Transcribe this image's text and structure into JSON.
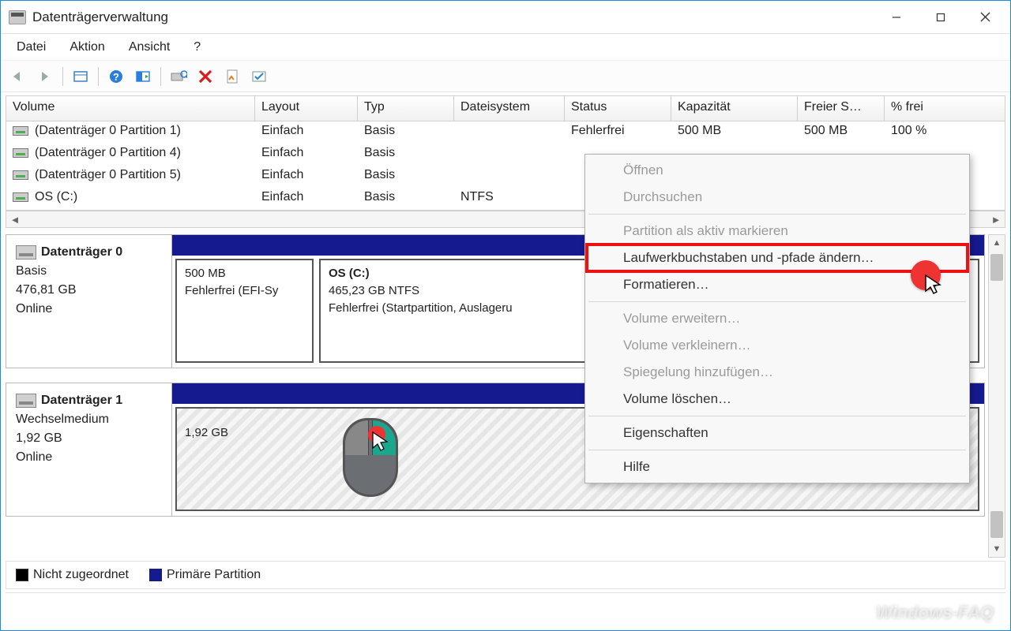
{
  "window": {
    "title": "Datenträgerverwaltung"
  },
  "menu": {
    "file": "Datei",
    "action": "Aktion",
    "view": "Ansicht",
    "help": "?"
  },
  "columns": {
    "volume": "Volume",
    "layout": "Layout",
    "type": "Typ",
    "fs": "Dateisystem",
    "status": "Status",
    "capacity": "Kapazität",
    "free": "Freier S…",
    "pfree": "% frei"
  },
  "volumes": [
    {
      "name": "(Datenträger 0 Partition 1)",
      "layout": "Einfach",
      "type": "Basis",
      "fs": "",
      "status": "Fehlerfrei",
      "capacity": "500 MB",
      "free": "500 MB",
      "pfree": "100 %"
    },
    {
      "name": "(Datenträger 0 Partition 4)",
      "layout": "Einfach",
      "type": "Basis",
      "fs": "",
      "status": "",
      "capacity": "",
      "free": "",
      "pfree": ""
    },
    {
      "name": "(Datenträger 0 Partition 5)",
      "layout": "Einfach",
      "type": "Basis",
      "fs": "",
      "status": "",
      "capacity": "",
      "free": "",
      "pfree": ""
    },
    {
      "name": "OS (C:)",
      "layout": "Einfach",
      "type": "Basis",
      "fs": "NTFS",
      "status": "",
      "capacity": "",
      "free": "",
      "pfree": ""
    }
  ],
  "disks": [
    {
      "name": "Datenträger 0",
      "type": "Basis",
      "size": "476,81 GB",
      "state": "Online",
      "parts": [
        {
          "title": "",
          "line1": "500 MB",
          "line2": "Fehlerfrei (EFI-Sy"
        },
        {
          "title": "OS  (C:)",
          "line1": "465,23 GB NTFS",
          "line2": "Fehlerfrei (Startpartition, Auslageru"
        }
      ]
    },
    {
      "name": "Datenträger 1",
      "type": "Wechselmedium",
      "size": "1,92 GB",
      "state": "Online",
      "parts": [
        {
          "title": "",
          "line1": "1,92 GB",
          "line2": ""
        }
      ]
    }
  ],
  "legend": {
    "unalloc": "Nicht zugeordnet",
    "primary": "Primäre Partition"
  },
  "ctx": {
    "open": "Öffnen",
    "browse": "Durchsuchen",
    "active": "Partition als aktiv markieren",
    "drive": "Laufwerkbuchstaben und -pfade ändern…",
    "format": "Formatieren…",
    "extend": "Volume erweitern…",
    "shrink": "Volume verkleinern…",
    "mirror": "Spiegelung hinzufügen…",
    "delete": "Volume löschen…",
    "props": "Eigenschaften",
    "help": "Hilfe"
  },
  "watermark": "Windows-FAQ"
}
